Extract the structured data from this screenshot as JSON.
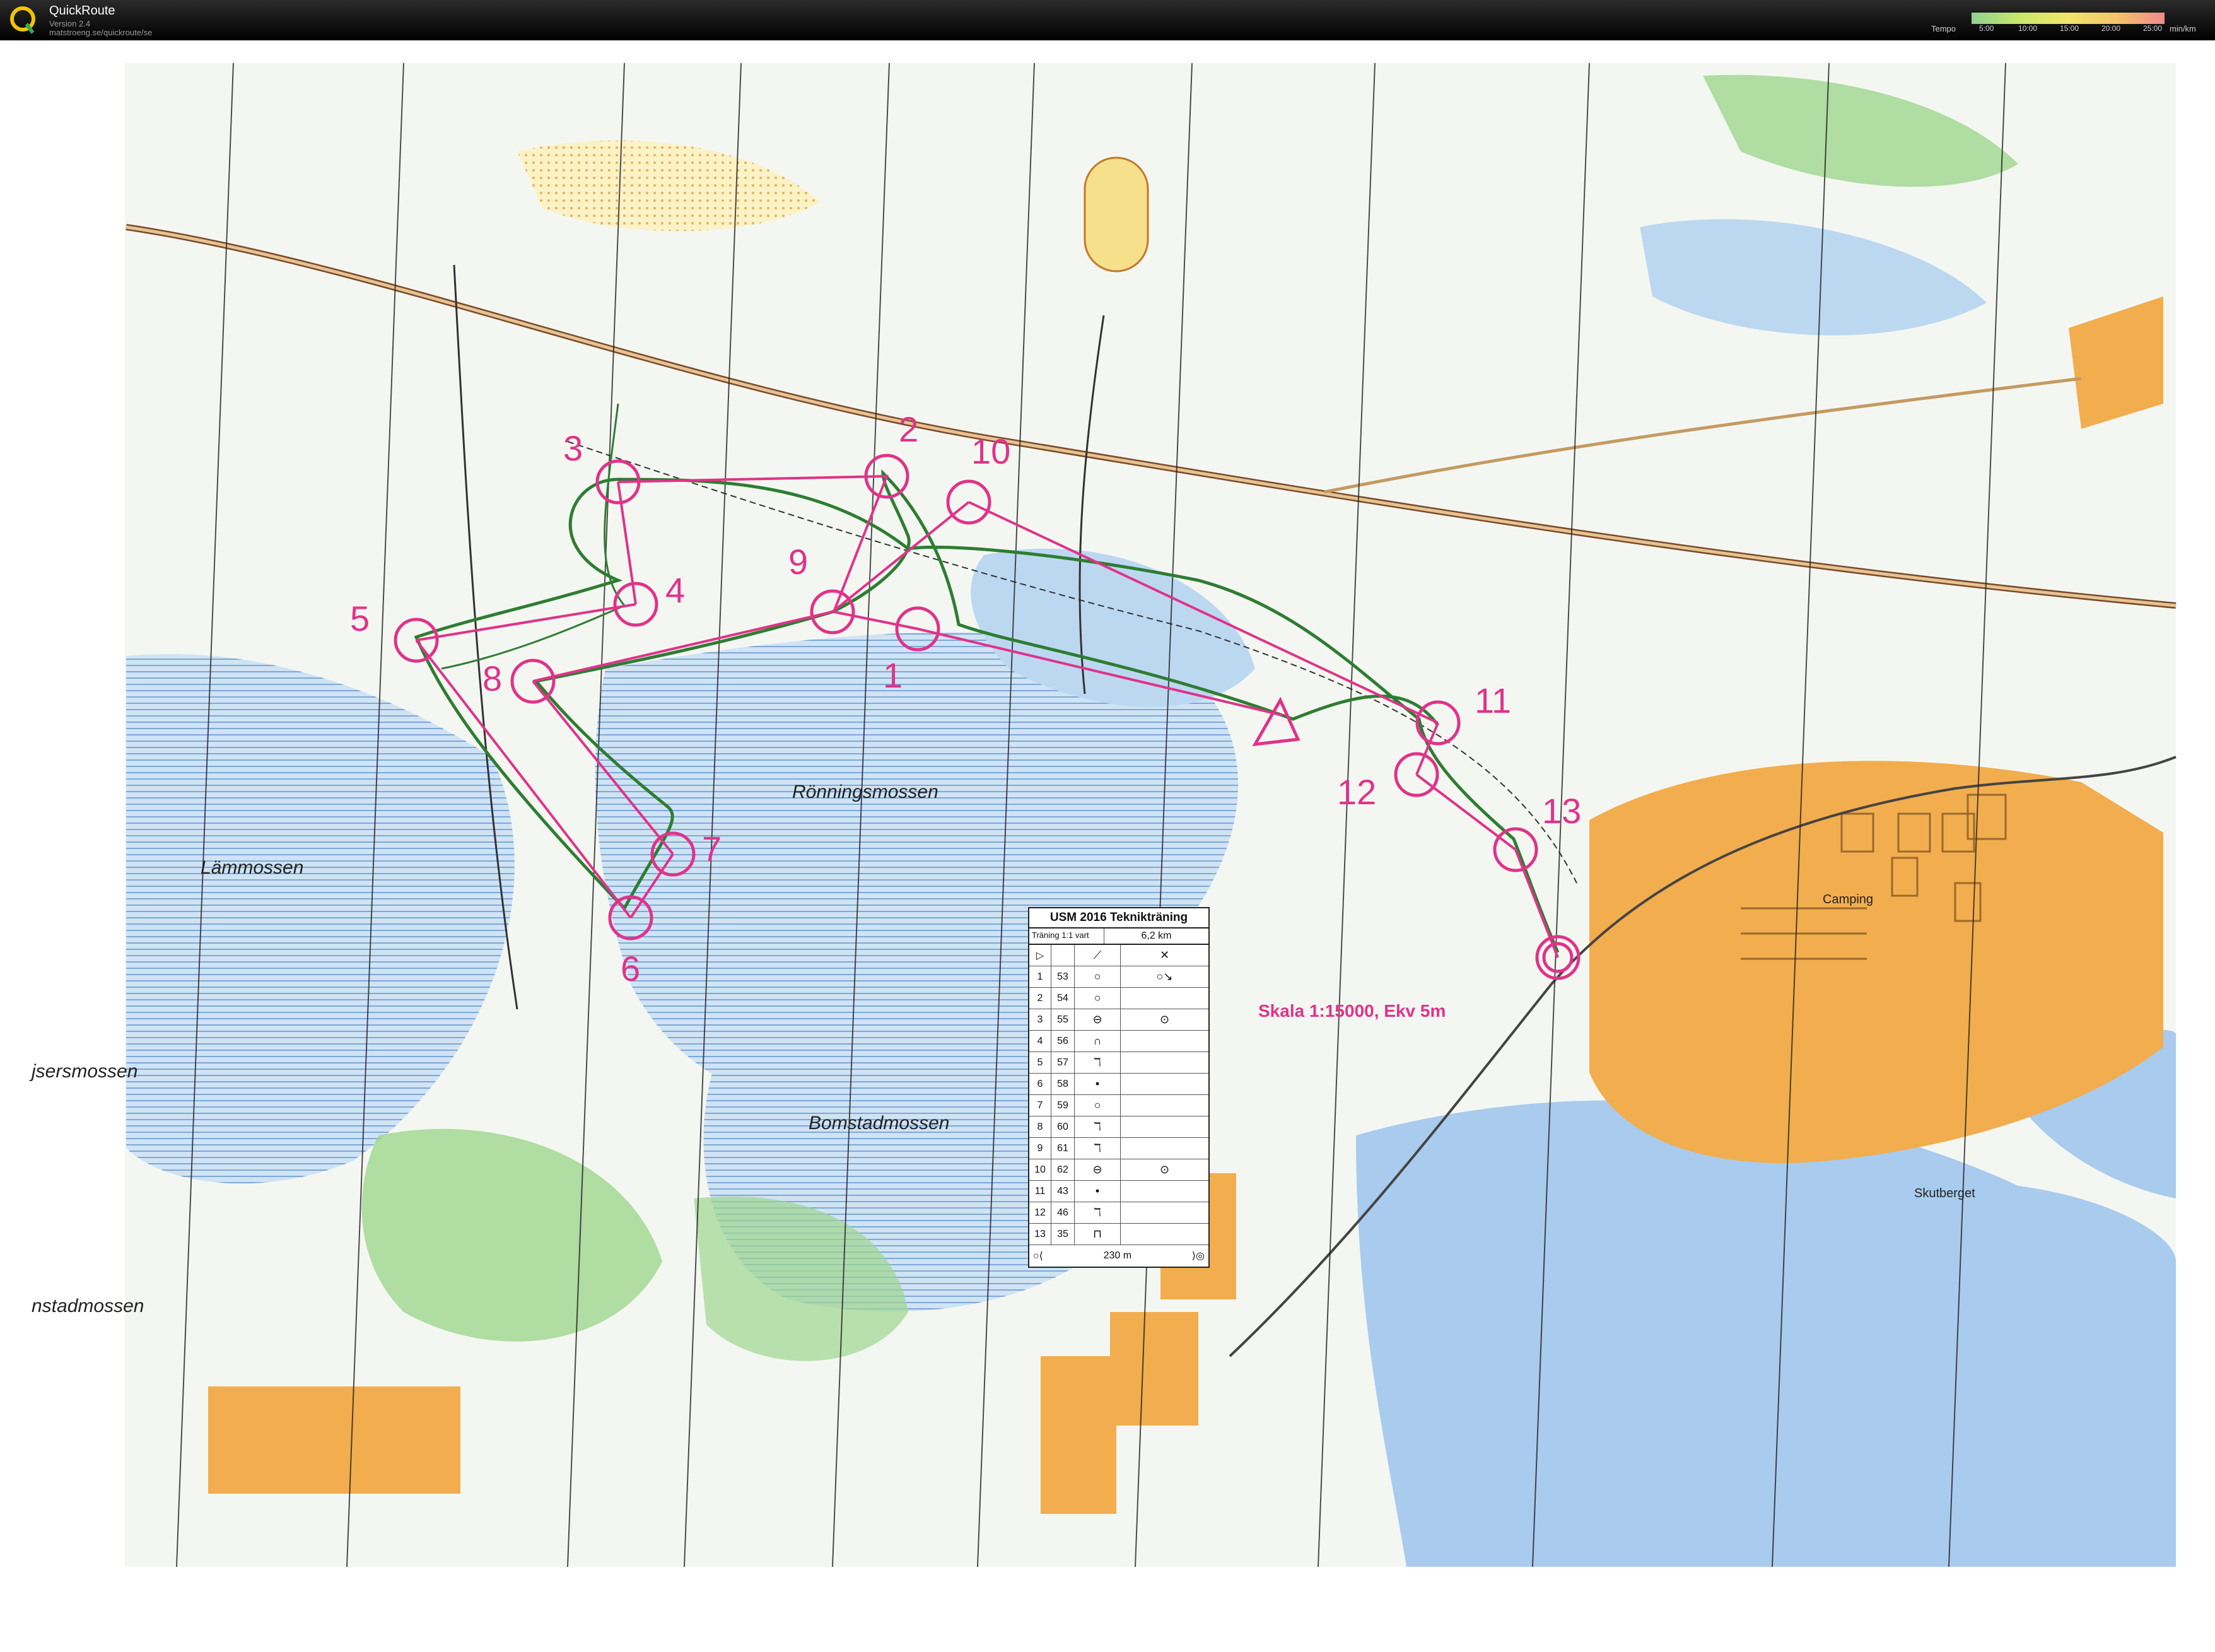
{
  "app": {
    "title": "QuickRoute",
    "version": "Version 2.4",
    "url": "matstroeng.se/quickroute/se"
  },
  "tempo": {
    "label": "Tempo",
    "ticks": [
      "5:00",
      "10:00",
      "15:00",
      "20:00",
      "25:00"
    ],
    "unit": "min/km"
  },
  "map": {
    "place_names": [
      "Lämmossen",
      "Rönningsmossen",
      "Bomstadmossen",
      "jsersmossen",
      "nstadmossen",
      "Camping",
      "Skutberget"
    ],
    "scale_text": "Skala 1:15000, Ekv 5m",
    "control_numbers": [
      "1",
      "2",
      "3",
      "4",
      "5",
      "6",
      "7",
      "8",
      "9",
      "10",
      "11",
      "12",
      "13"
    ],
    "colors": {
      "course": "#e0338a",
      "route": "#2e7d32",
      "water": "#a9cbee",
      "urban": "#f2ad4e",
      "forest_green": "#9ed68e",
      "open": "#f7e08c"
    }
  },
  "description": {
    "title": "USM 2016 Teknikträning",
    "subtitle": "Träning 1:1 vart",
    "distance": "6,2 km",
    "rows": [
      {
        "n": "1",
        "code": "53",
        "feature": "○",
        "detail": "○↘"
      },
      {
        "n": "2",
        "code": "54",
        "feature": "○",
        "detail": ""
      },
      {
        "n": "3",
        "code": "55",
        "feature": "⊖",
        "detail": "⊙"
      },
      {
        "n": "4",
        "code": "56",
        "feature": "∩",
        "detail": ""
      },
      {
        "n": "5",
        "code": "57",
        "feature": "ℸ",
        "detail": ""
      },
      {
        "n": "6",
        "code": "58",
        "feature": "•",
        "detail": ""
      },
      {
        "n": "7",
        "code": "59",
        "feature": "○",
        "detail": ""
      },
      {
        "n": "8",
        "code": "60",
        "feature": "ℸ",
        "detail": ""
      },
      {
        "n": "9",
        "code": "61",
        "feature": "ℸ",
        "detail": ""
      },
      {
        "n": "10",
        "code": "62",
        "feature": "⊖",
        "detail": "⊙"
      },
      {
        "n": "11",
        "code": "43",
        "feature": "•",
        "detail": ""
      },
      {
        "n": "12",
        "code": "46",
        "feature": "ℸ",
        "detail": ""
      },
      {
        "n": "13",
        "code": "35",
        "feature": "⊓",
        "detail": ""
      }
    ],
    "footer": "230 m"
  }
}
